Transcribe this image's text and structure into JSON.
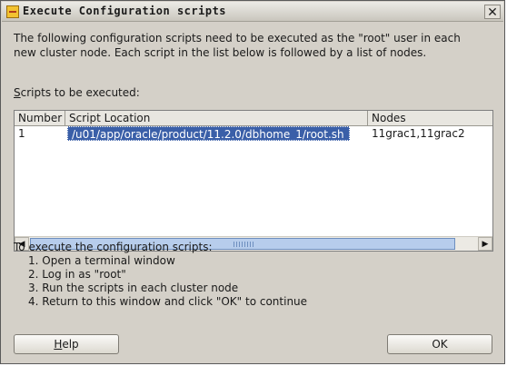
{
  "window": {
    "title": "Execute Configuration scripts",
    "close_glyph": "✕"
  },
  "intro_text": "The following configuration scripts need to be executed as the \"root\" user in each new cluster node. Each script in the list below is followed by a list of nodes.",
  "scripts_label": {
    "mnemonic": "S",
    "rest": "cripts to be executed:"
  },
  "table": {
    "columns": [
      "Number",
      "Script Location",
      "Nodes"
    ],
    "rows": [
      {
        "number": "1",
        "location": "/u01/app/oracle/product/11.2.0/dbhome_1/root.sh",
        "nodes": "11grac1,11grac2"
      }
    ]
  },
  "instructions": {
    "heading": "To execute the configuration scripts:",
    "steps": [
      "1. Open a terminal window",
      "2. Log in as \"root\"",
      "3. Run the scripts in each cluster node",
      "4. Return to this window and click \"OK\" to continue"
    ]
  },
  "buttons": {
    "help": {
      "mnemonic": "H",
      "rest": "elp"
    },
    "ok": "OK"
  },
  "icons": {
    "title": "oracle-installer-icon",
    "scroll_left": "◀",
    "scroll_right": "▶"
  },
  "colors": {
    "dialog_bg": "#d4d0c8",
    "selection": "#3a5fa8",
    "scroll_thumb": "#b7cdec"
  }
}
